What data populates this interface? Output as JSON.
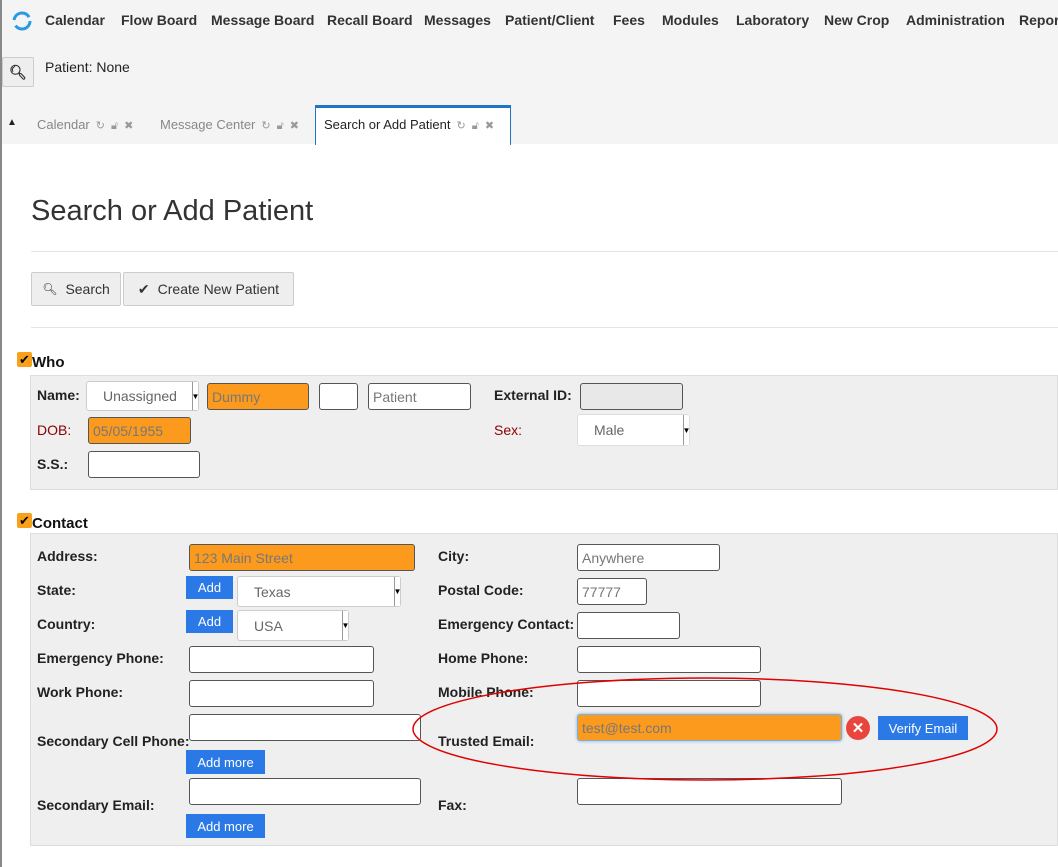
{
  "nav": {
    "items": [
      "Calendar",
      "Flow Board",
      "Message Board",
      "Recall Board",
      "Messages",
      "Patient/Client",
      "Fees",
      "Modules",
      "Laboratory",
      "New Crop",
      "Administration",
      "Repor"
    ]
  },
  "patient_status": "Patient: None",
  "tabs": [
    {
      "label": "Calendar"
    },
    {
      "label": "Message Center"
    },
    {
      "label": "Search or Add Patient",
      "active": true
    }
  ],
  "page": {
    "title": "Search or Add Patient",
    "search_label": "Search",
    "create_label": "Create New Patient"
  },
  "who": {
    "heading": "Who",
    "name_label": "Name:",
    "title_value": "Unassigned",
    "first_name": "Dummy",
    "middle_name": "",
    "last_name": "Patient",
    "external_id_label": "External ID:",
    "dob_label": "DOB:",
    "dob_value": "05/05/1955",
    "sex_label": "Sex:",
    "sex_value": "Male",
    "ss_label": "S.S.:"
  },
  "contact": {
    "heading": "Contact",
    "address_label": "Address:",
    "address_value": "123 Main Street",
    "city_label": "City:",
    "city_value": "Anywhere",
    "state_label": "State:",
    "state_value": "Texas",
    "postal_label": "Postal Code:",
    "postal_value": "77777",
    "country_label": "Country:",
    "country_value": "USA",
    "emergency_contact_label": "Emergency Contact:",
    "emergency_phone_label": "Emergency Phone:",
    "home_phone_label": "Home Phone:",
    "work_phone_label": "Work Phone:",
    "mobile_phone_label": "Mobile Phone:",
    "secondary_cell_label": "Secondary Cell Phone:",
    "trusted_email_label": "Trusted Email:",
    "trusted_email_value": "test@test.com",
    "verify_label": "Verify Email",
    "secondary_email_label": "Secondary Email:",
    "fax_label": "Fax:",
    "add_label": "Add",
    "add_more_label": "Add more"
  },
  "colors": {
    "highlight": "#fc9a1d",
    "accent": "#2a79e6",
    "annotation": "#e00000"
  }
}
